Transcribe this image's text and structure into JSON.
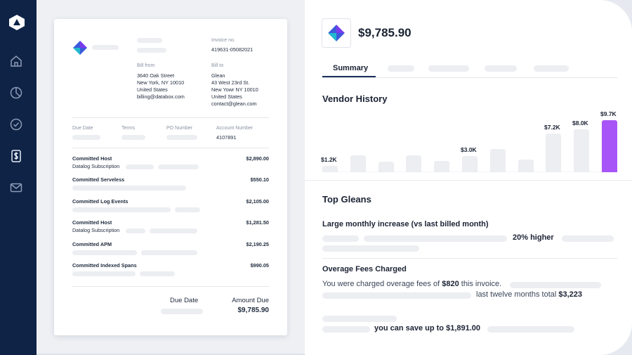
{
  "sidebar": {
    "icons": [
      "logo-icon",
      "home-icon",
      "chart-pie-icon",
      "check-circle-icon",
      "invoice-dollar-icon",
      "mail-icon"
    ],
    "bg": "#0f2346"
  },
  "invoice": {
    "invoice_no_label": "Invoice no.",
    "invoice_no": "419631-05082021",
    "bill_from_label": "Bill from",
    "bill_from_lines": [
      "3640 Oak Street",
      "New York, NY 10010",
      "United States",
      "billing@databox.com"
    ],
    "bill_to_label": "Bill to",
    "bill_to_lines": [
      "Glean",
      "43 West 23rd St.",
      "New Yowr NY 10010",
      "United States",
      "contact@glean.com"
    ],
    "due_date_label": "Due Date",
    "terms_label": "Terms",
    "po_label": "PO Number",
    "account_label": "Account Number",
    "account_number": "4107891",
    "items": [
      {
        "name": "Committed Host",
        "sub": "Datalog Subscription",
        "amount": "$2,890.00"
      },
      {
        "name": "Committed Serveless",
        "sub": "",
        "amount": "$550.10"
      },
      {
        "name": "Committed Log Events",
        "sub": "",
        "amount": "$2,105.00"
      },
      {
        "name": "Committed Host",
        "sub": "Datalog Subscription",
        "amount": "$1,281.50"
      },
      {
        "name": "Committed APM",
        "sub": "",
        "amount": "$2,190.25"
      },
      {
        "name": "Committed Indexed Spans",
        "sub": "",
        "amount": "$990.05"
      }
    ],
    "footer_due_label": "Due Date",
    "footer_amount_label": "Amount Due",
    "footer_amount": "$9,785.90"
  },
  "summary": {
    "amount": "$9,785.90",
    "tab_active": "Summary",
    "vendor_history_title": "Vendor History",
    "top_gleans_title": "Top Gleans",
    "insight1_title": "Large monthly increase (vs last billed month)",
    "insight1_value": "20% higher",
    "insight2_title": "Overage Fees Charged",
    "insight2_line1_a": "You were charged overage fees of ",
    "insight2_line1_b": "$820",
    "insight2_line1_c": " this invoice.",
    "insight2_line2_a": "last twelve months total ",
    "insight2_line2_b": "$3,223",
    "insight3_a": "you can save up to ",
    "insight3_b": "$1,891.00",
    "accent": "#a855f7",
    "check_color": "#2dbf6c"
  },
  "chart_data": {
    "type": "bar",
    "categories": [
      "",
      "",
      "",
      "",
      "",
      "",
      "",
      "",
      "",
      "",
      ""
    ],
    "values": [
      1.2,
      3.1,
      2.0,
      3.2,
      2.1,
      3.0,
      4.3,
      2.3,
      7.2,
      8.0,
      9.7
    ],
    "labels": [
      "$1.2K",
      "",
      "",
      "",
      "",
      "$3.0K",
      "",
      "",
      "$7.2K",
      "$8.0K",
      "$9.7K"
    ],
    "highlight_index": 10,
    "ylim": [
      0,
      9.7
    ]
  }
}
